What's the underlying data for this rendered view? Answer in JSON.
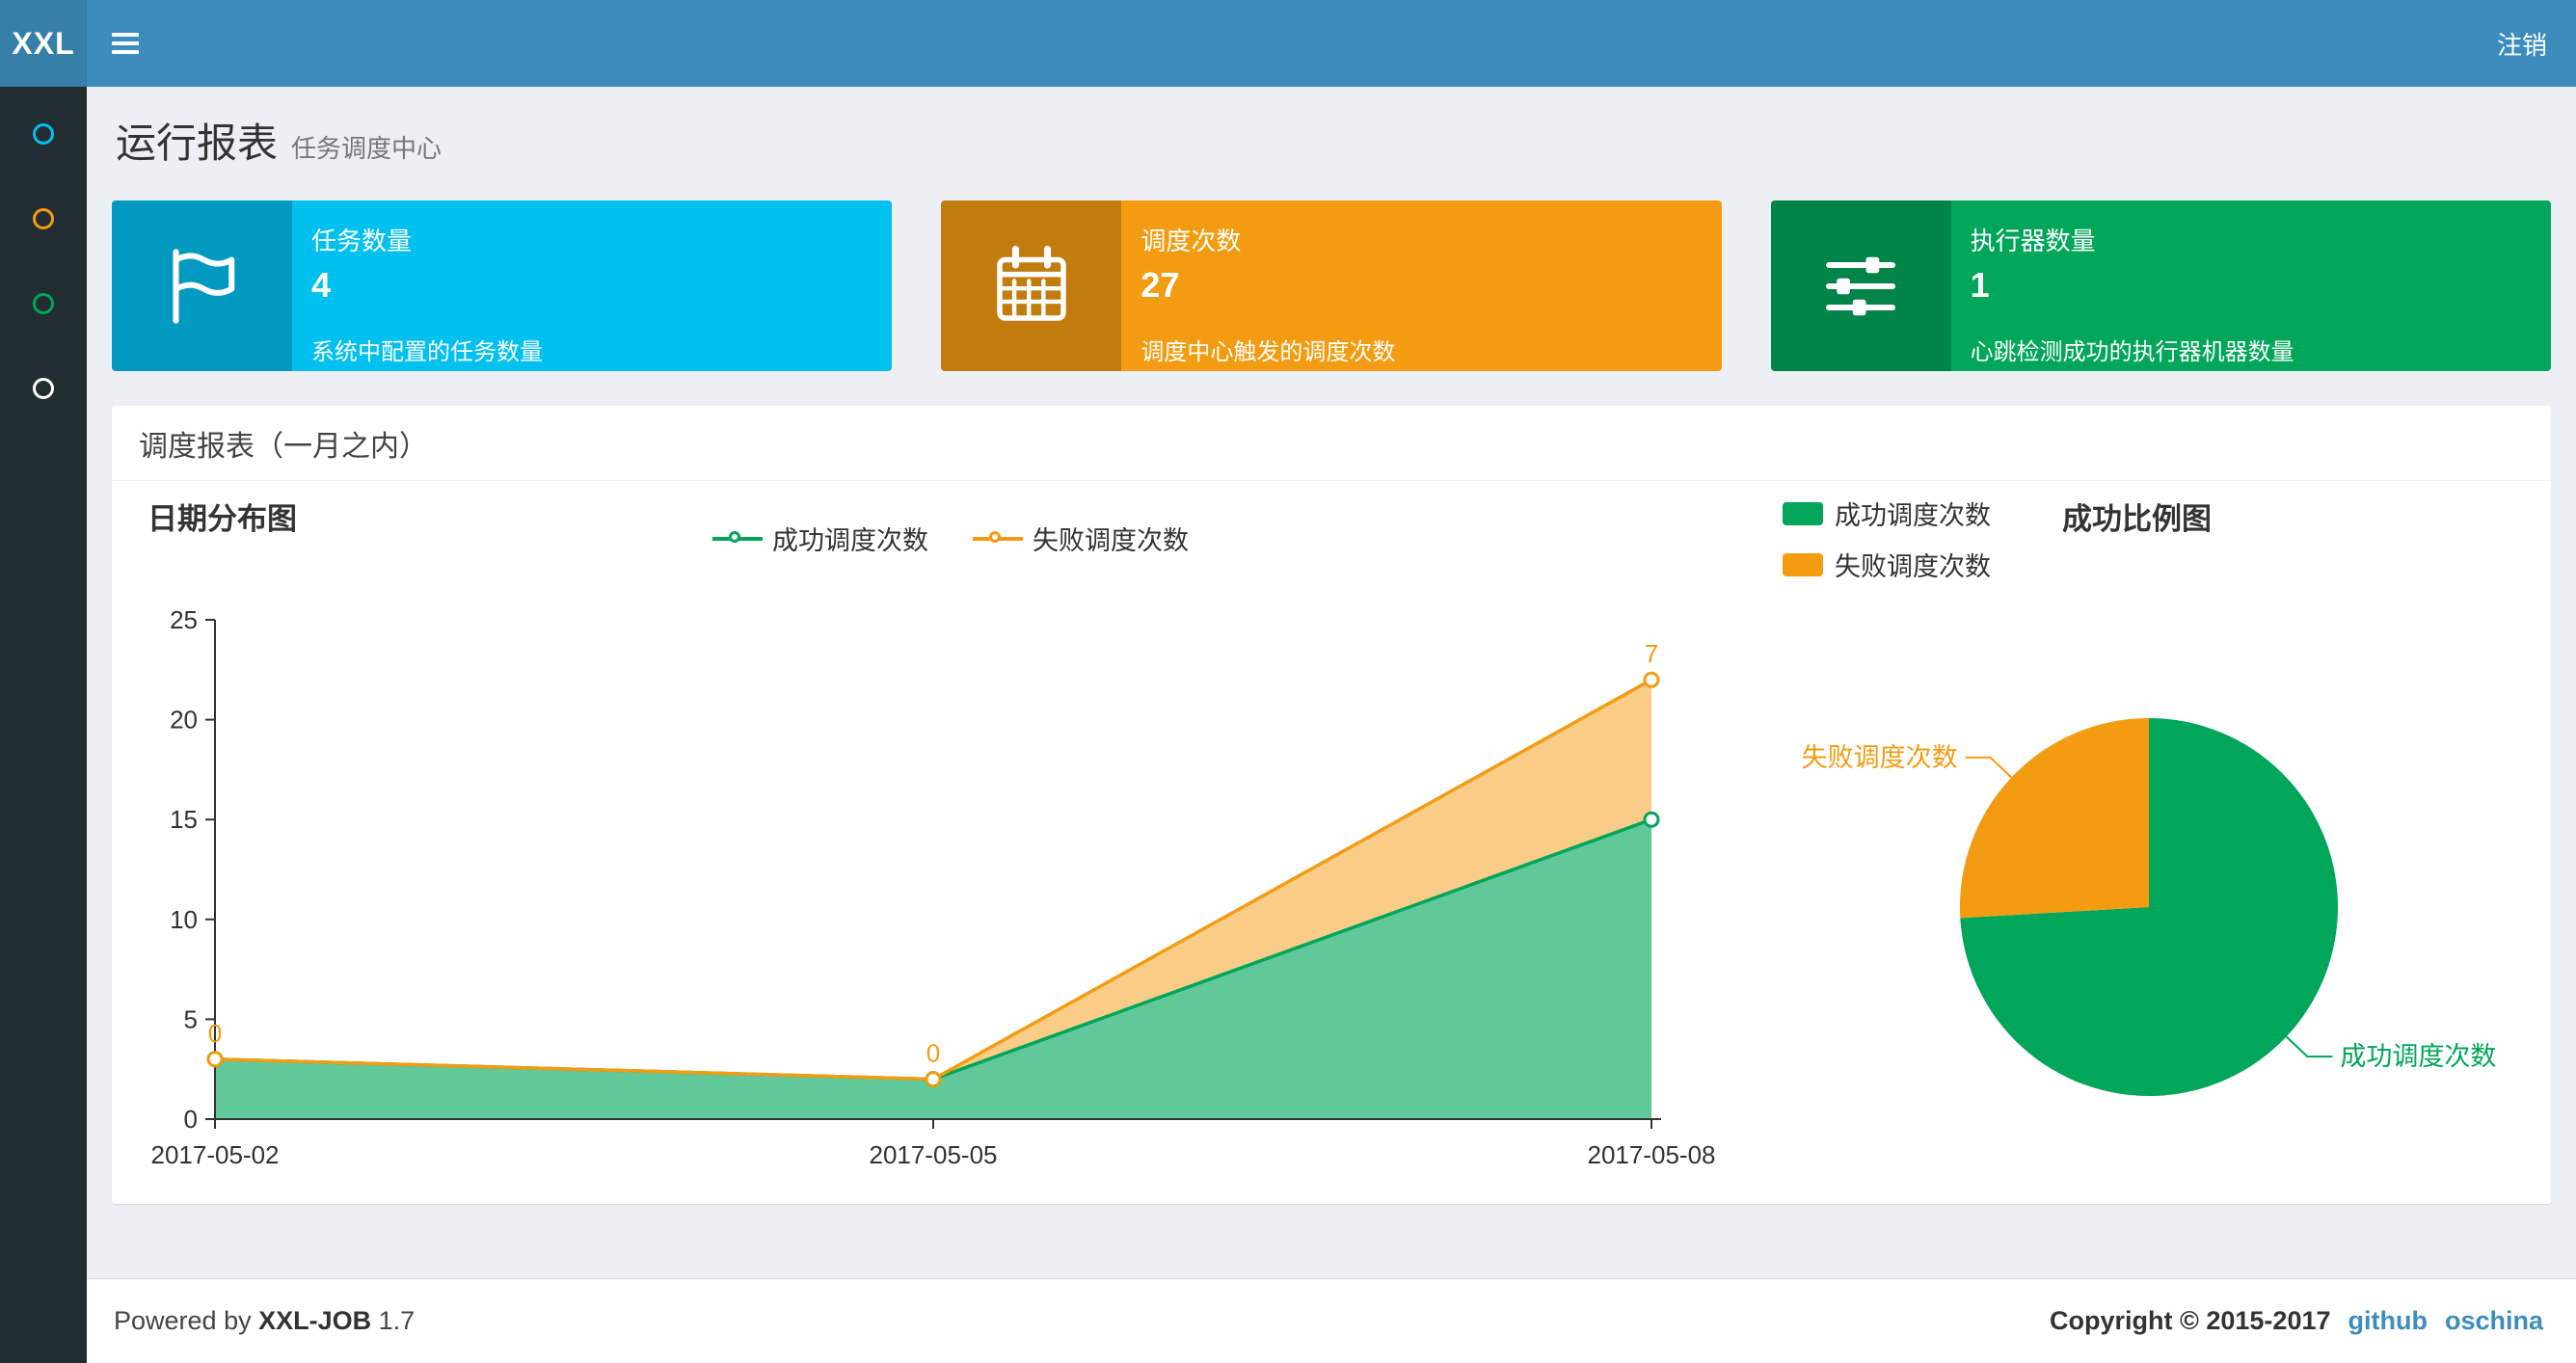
{
  "colors": {
    "header": "#3c8dbc",
    "logo_bg": "#367fa9",
    "sidebar_bg": "#222d32",
    "info": "#00c0ef",
    "warning": "#f39c12",
    "success": "#00a65a",
    "link": "#3c8dbc"
  },
  "header": {
    "logo_text": "XXL",
    "logout_label": "注销"
  },
  "sidebar": {
    "items": [
      {
        "icon": "circle-icon",
        "style": "border-color:#00c0ef"
      },
      {
        "icon": "circle-icon",
        "style": "border-color:#f39c12"
      },
      {
        "icon": "circle-icon",
        "style": "border-color:#00a65a"
      },
      {
        "icon": "circle-icon",
        "style": "border-color:#ffffff"
      }
    ]
  },
  "page_header": {
    "title": "运行报表",
    "subtitle": "任务调度中心"
  },
  "info_boxes": [
    {
      "title": "任务数量",
      "number": "4",
      "desc": "系统中配置的任务数量",
      "icon": "flag-icon",
      "style": "background-color:#00c0ef"
    },
    {
      "title": "调度次数",
      "number": "27",
      "desc": "调度中心触发的调度次数",
      "icon": "calendar-icon",
      "style": "background-color:#f39c12"
    },
    {
      "title": "执行器数量",
      "number": "1",
      "desc": "心跳检测成功的执行器机器数量",
      "icon": "sliders-icon",
      "style": "background-color:#00a65a"
    }
  ],
  "panel": {
    "title": "调度报表（一月之内）"
  },
  "chart_data": [
    {
      "type": "area",
      "title": "日期分布图",
      "stacked": true,
      "categories": [
        "2017-05-02",
        "2017-05-05",
        "2017-05-08"
      ],
      "series": [
        {
          "name": "成功调度次数",
          "values": [
            3,
            2,
            15
          ],
          "color": "#00a65a",
          "show_point_labels": false
        },
        {
          "name": "失败调度次数",
          "values": [
            0,
            0,
            7
          ],
          "color": "#f39c12",
          "show_point_labels": true
        }
      ],
      "visible_point_labels": [
        "0",
        "0",
        "7"
      ],
      "ylim": [
        0,
        25
      ],
      "yticks": [
        0,
        5,
        10,
        15,
        20,
        25
      ],
      "legend_position": "top",
      "grid": false
    },
    {
      "type": "pie",
      "title": "成功比例图",
      "legend_position": "top-left",
      "slices": [
        {
          "label": "成功调度次数",
          "value": 20,
          "color": "#00a65a"
        },
        {
          "label": "失败调度次数",
          "value": 7,
          "color": "#f39c12"
        }
      ]
    }
  ],
  "footer": {
    "powered_by_prefix": "Powered by",
    "product": "XXL-JOB",
    "version": "1.7",
    "copyright": "Copyright © 2015-2017",
    "links": [
      {
        "label": "github"
      },
      {
        "label": "oschina"
      }
    ]
  }
}
